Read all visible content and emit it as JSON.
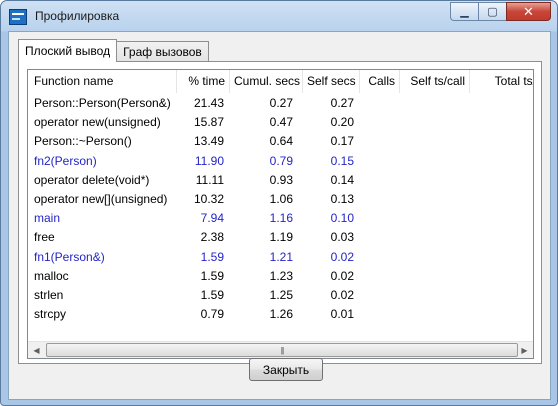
{
  "window": {
    "title": "Профилировка",
    "controls": {
      "minimize": "▁",
      "maximize": "▢",
      "close": "✕"
    }
  },
  "tabs": [
    {
      "label": "Плоский вывод",
      "active": true
    },
    {
      "label": "Граф вызовов",
      "active": false
    }
  ],
  "table": {
    "columns": [
      "Function name",
      "% time",
      "Cumul. secs",
      "Self secs",
      "Calls",
      "Self ts/call",
      "Total ts/call"
    ],
    "rows": [
      {
        "name": "Person::Person(Person&)",
        "time": "21.43",
        "cumul": "0.27",
        "self": "0.27",
        "blue": false
      },
      {
        "name": "operator new(unsigned)",
        "time": "15.87",
        "cumul": "0.47",
        "self": "0.20",
        "blue": false
      },
      {
        "name": "Person::~Person()",
        "time": "13.49",
        "cumul": "0.64",
        "self": "0.17",
        "blue": false
      },
      {
        "name": "fn2(Person)",
        "time": "11.90",
        "cumul": "0.79",
        "self": "0.15",
        "blue": true
      },
      {
        "name": "operator delete(void*)",
        "time": "11.11",
        "cumul": "0.93",
        "self": "0.14",
        "blue": false
      },
      {
        "name": "operator new[](unsigned)",
        "time": "10.32",
        "cumul": "1.06",
        "self": "0.13",
        "blue": false
      },
      {
        "name": "main",
        "time": "7.94",
        "cumul": "1.16",
        "self": "0.10",
        "blue": true
      },
      {
        "name": "free",
        "time": "2.38",
        "cumul": "1.19",
        "self": "0.03",
        "blue": false
      },
      {
        "name": "fn1(Person&)",
        "time": "1.59",
        "cumul": "1.21",
        "self": "0.02",
        "blue": true
      },
      {
        "name": "malloc",
        "time": "1.59",
        "cumul": "1.23",
        "self": "0.02",
        "blue": false
      },
      {
        "name": "strlen",
        "time": "1.59",
        "cumul": "1.25",
        "self": "0.02",
        "blue": false
      },
      {
        "name": "strcpy",
        "time": "0.79",
        "cumul": "1.26",
        "self": "0.01",
        "blue": false
      }
    ],
    "colors": {
      "highlight": "#2424c8"
    }
  },
  "scrollbar": {
    "left_arrow": "◀",
    "right_arrow": "▶",
    "grip": "|||"
  },
  "footer": {
    "close_label": "Закрыть"
  }
}
